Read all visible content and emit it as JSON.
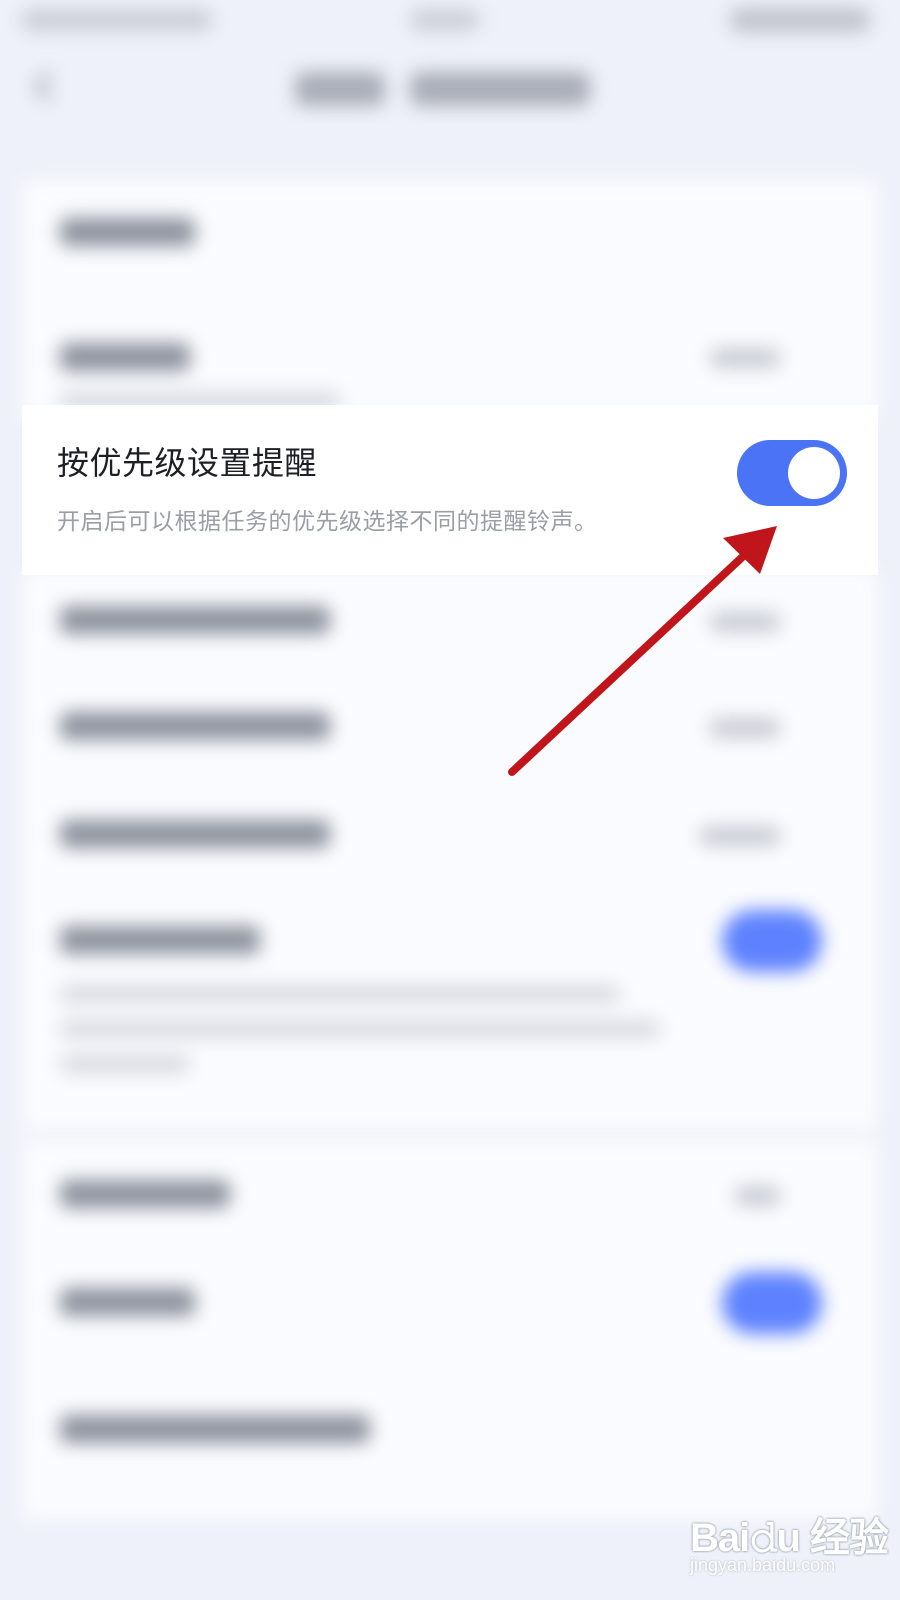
{
  "setting": {
    "title": "按优先级设置提醒",
    "description": "开启后可以根据任务的优先级选择不同的提醒铃声。",
    "enabled": true
  },
  "colors": {
    "toggle_on": "#4a74f5",
    "arrow": "#c0161b",
    "background": "#eef1f9"
  },
  "watermark": {
    "logo": "Bai𝚍u 经验",
    "url": "jingyan.baidu.com"
  }
}
